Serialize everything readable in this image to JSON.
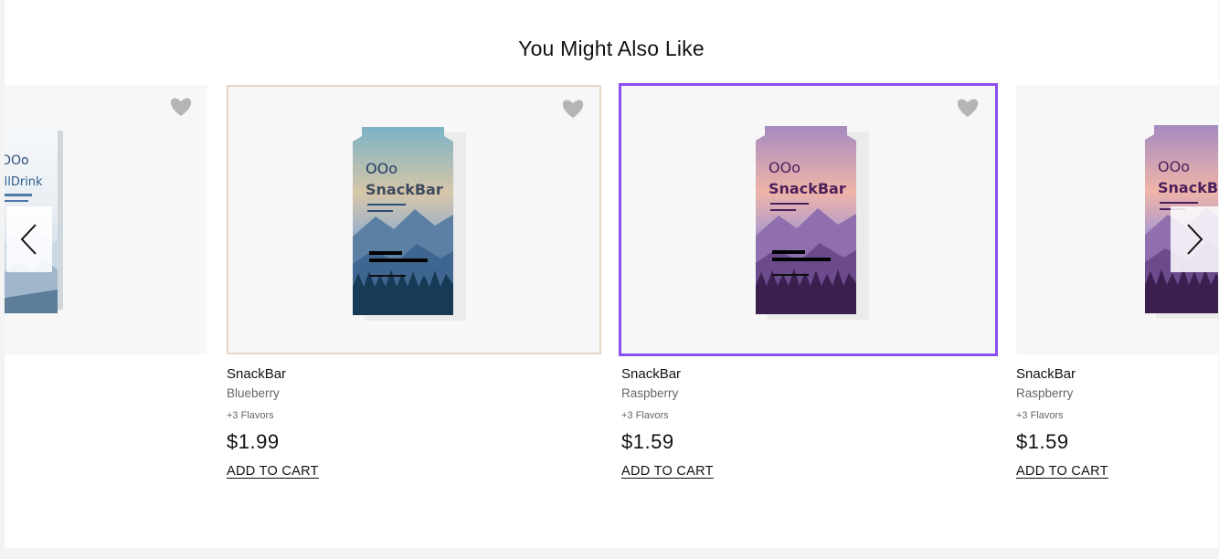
{
  "section": {
    "title": "You Might Also Like"
  },
  "carousel": {
    "prev_icon": "chevron-left-icon",
    "next_icon": "chevron-right-icon"
  },
  "products": [
    {
      "brand_text": "illDrink",
      "logo": "OOo"
    },
    {
      "name": "SnackBar",
      "flavor": "Blueberry",
      "more": "+3 Flavors",
      "price": "$1.99",
      "cart": "ADD TO CART",
      "brand_text": "SnackBar",
      "logo": "OOo",
      "theme": "blue"
    },
    {
      "name": "SnackBar",
      "flavor": "Raspberry",
      "more": "+3 Flavors",
      "price": "$1.59",
      "cart": "ADD TO CART",
      "brand_text": "SnackBar",
      "logo": "OOo",
      "theme": "purple"
    },
    {
      "name": "SnackBar",
      "flavor": "Raspberry",
      "more": "+3 Flavors",
      "price": "$1.59",
      "cart": "ADD TO CART",
      "brand_text": "SnackB",
      "logo": "OOo",
      "theme": "purple"
    }
  ],
  "colors": {
    "selected_border": "#8b4ff0",
    "card_border": "#e4d8c2",
    "heart": "#b5b5b5"
  }
}
